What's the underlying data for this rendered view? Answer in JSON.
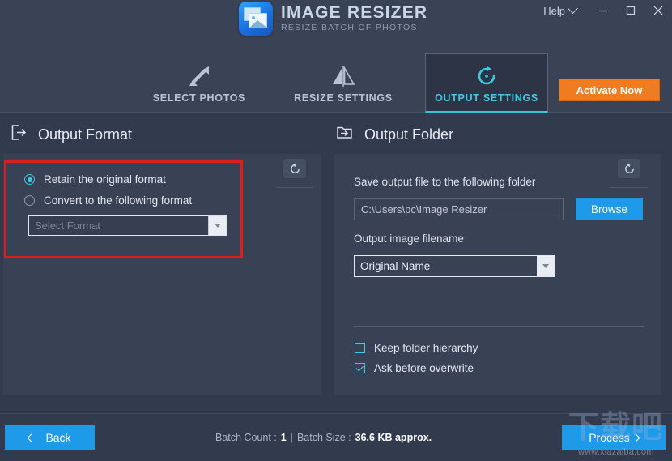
{
  "window": {
    "help_label": "Help",
    "minimize_icon": "minimize-icon",
    "maximize_icon": "maximize-icon",
    "close_icon": "close-icon"
  },
  "brand": {
    "title": "IMAGE RESIZER",
    "subtitle": "RESIZE BATCH OF PHOTOS",
    "logo_icon": "image-resizer-logo"
  },
  "tabs": [
    {
      "label": "SELECT PHOTOS",
      "icon": "expand-arrows-icon",
      "active": false
    },
    {
      "label": "RESIZE SETTINGS",
      "icon": "resize-mirror-icon",
      "active": false
    },
    {
      "label": "OUTPUT SETTINGS",
      "icon": "refresh-circle-icon",
      "active": true
    }
  ],
  "activate": {
    "label": "Activate Now",
    "color": "#f07c22"
  },
  "output_format": {
    "heading": "Output Format",
    "heading_icon": "export-document-icon",
    "reset_icon": "reset-icon",
    "options": [
      {
        "label": "Retain the original format",
        "selected": true
      },
      {
        "label": "Convert to the following format",
        "selected": false
      }
    ],
    "format_select": {
      "placeholder": "Select Format",
      "value": "",
      "disabled": true
    }
  },
  "output_folder": {
    "heading": "Output Folder",
    "heading_icon": "folder-export-icon",
    "reset_icon": "reset-icon",
    "folder_label": "Save output file to the following folder",
    "folder_path": "C:\\Users\\pc\\Image Resizer",
    "browse_label": "Browse",
    "filename_label": "Output image filename",
    "filename_value": "Original Name",
    "checkboxes": [
      {
        "label": "Keep folder hierarchy",
        "checked": false
      },
      {
        "label": "Ask before overwrite",
        "checked": true
      }
    ]
  },
  "footer": {
    "back_label": "Back",
    "process_label": "Process",
    "batch_count_label": "Batch Count :",
    "batch_count_value": "1",
    "separator": "|",
    "batch_size_label": "Batch Size :",
    "batch_size_value": "36.6 KB approx."
  },
  "watermark": {
    "text": "下载吧",
    "url": "www.xiazaiba.com"
  },
  "colors": {
    "background": "#323b4d",
    "panel": "#394254",
    "accent_teal": "#3fc9e4",
    "accent_blue": "#1e9ae8",
    "accent_orange": "#f07c22",
    "annotation_red": "#e01b1b"
  }
}
